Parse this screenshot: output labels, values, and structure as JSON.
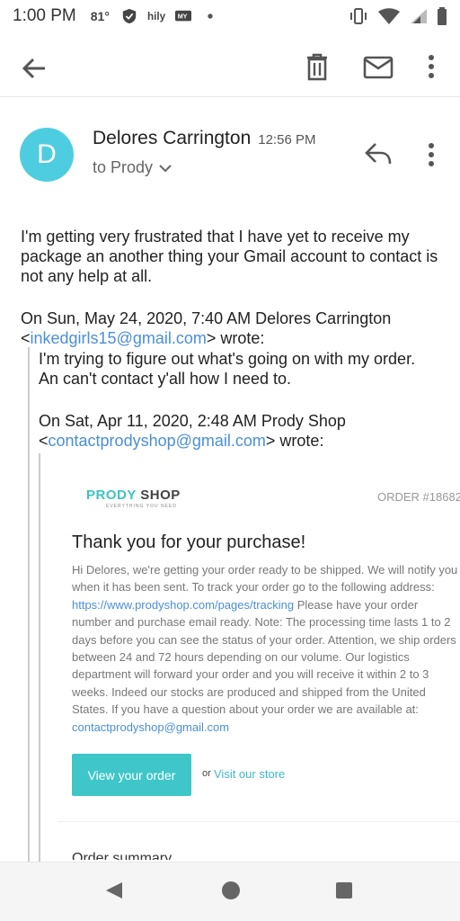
{
  "status_bar": {
    "time": "1:00 PM",
    "temperature": "81°",
    "icons_left": [
      "shield-icon",
      "hily-icon",
      "message-icon",
      "dot-icon"
    ],
    "icons_right": [
      "vibrate-icon",
      "wifi-icon",
      "signal-icon",
      "battery-icon"
    ]
  },
  "app_bar": {
    "icons": [
      "back-arrow-icon",
      "trash-icon",
      "mail-icon",
      "more-vert-icon"
    ]
  },
  "email": {
    "avatar_letter": "D",
    "sender": "Delores Carrington",
    "time": "12:56 PM",
    "to": "to Prody",
    "body": "I'm getting very frustrated that I have yet to receive my package an another thing your Gmail account to contact is not any help at all.",
    "quote1_header_a": "On Sun, May 24, 2020, 7:40 AM Delores Carrington",
    "quote1_email": "inkedgirls15@gmail.com",
    "quote1_header_b": "wrote:",
    "quote1_body": "I'm trying to figure out what's going on with my order. An can't contact y'all how I need to.",
    "quote2_header_a": "On Sat, Apr 11, 2020, 2:48 AM Prody Shop",
    "quote2_email": "contactprodyshop@gmail.com",
    "quote2_header_b": "wrote:"
  },
  "shop_email": {
    "logo_part1": "PRODY",
    "logo_part2": "SHOP",
    "logo_tagline": "EVERYTHING YOU NEED",
    "order_number": "ORDER #18682",
    "heading": "Thank you for your purchase!",
    "text_a": "Hi Delores, we're getting your order ready to be shipped. We will notify you when it has been sent. To track your order go to the following address: ",
    "tracking_link": "https://www.prodyshop.com/pages/tracking",
    "text_b": " Please have your order number and purchase email ready. Note: The processing time lasts 1 to 2 days before you can see the status of your order. Attention, we ship orders between 24 and 72 hours depending on our volume. Our logistics department will forward your order and you will receive it within 2 to 3 weeks. Indeed our stocks are produced and shipped from the United States. If you have a question about your order we are available at: ",
    "contact_email": "contactprodyshop@gmail.com",
    "button_label": "View your order",
    "or_label": "or",
    "store_link": "Visit our store",
    "order_summary": "Order summary"
  },
  "nav_bar": {
    "icons": [
      "nav-back-icon",
      "nav-home-icon",
      "nav-recents-icon"
    ]
  }
}
